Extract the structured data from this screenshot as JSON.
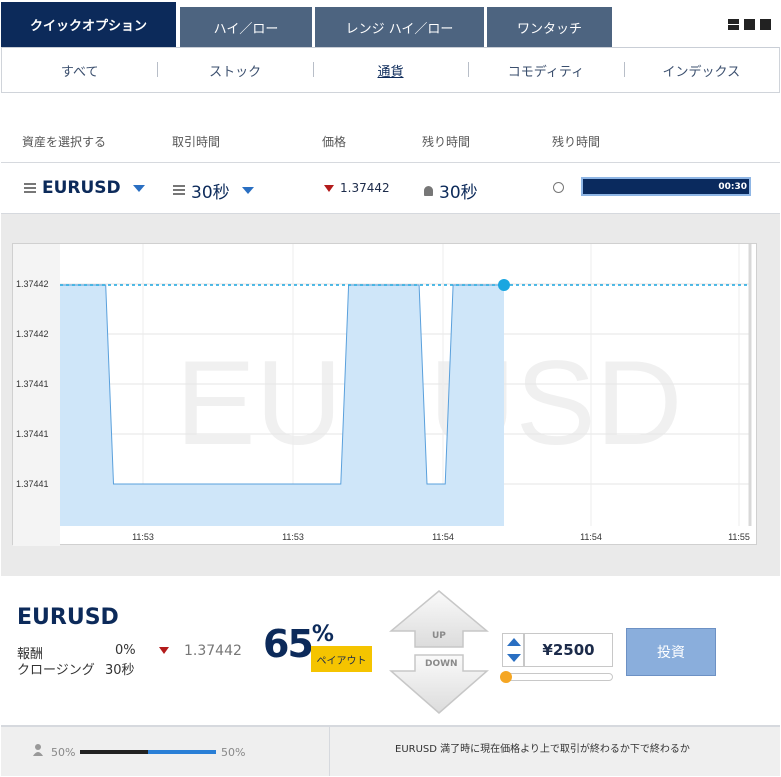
{
  "tabs": [
    {
      "label": "クイックオプション",
      "active": true
    },
    {
      "label": "ハイ／ロー",
      "active": false
    },
    {
      "label": "レンジ ハイ／ロー",
      "active": false
    },
    {
      "label": "ワンタッチ",
      "active": false
    }
  ],
  "categories": [
    {
      "label": "すべて",
      "active": false
    },
    {
      "label": "ストック",
      "active": false
    },
    {
      "label": "通貨",
      "active": true
    },
    {
      "label": "コモディティ",
      "active": false
    },
    {
      "label": "インデックス",
      "active": false
    }
  ],
  "column_labels": {
    "asset": "資産を選択する",
    "period": "取引時間",
    "price": "価格",
    "remaining1": "残り時間",
    "remaining2": "残り時間"
  },
  "selector": {
    "asset": "EURUSD",
    "duration": "30秒",
    "price": "1.37442",
    "remaining": "30秒",
    "timer": "00:30",
    "timer_progress_pct": 100
  },
  "chart_data": {
    "type": "area",
    "watermark": "EURUSD",
    "y_ticks": [
      "1.37442",
      "1.37442",
      "1.37441",
      "1.37441",
      "1.37441"
    ],
    "x_ticks": [
      "11:53",
      "11:53",
      "11:54",
      "11:54",
      "11:55"
    ],
    "current_price": "1.37442",
    "series_shape": [
      "high",
      "high",
      "low",
      "low",
      "low",
      "low",
      "low",
      "low",
      "low",
      "low",
      "low",
      "high",
      "high",
      "high",
      "low",
      "high",
      "high",
      "high"
    ],
    "fill_color": "#cfe6f9",
    "line_color": "#5aa0dc",
    "current_line_color": "#1aa6e0"
  },
  "panel": {
    "asset": "EURUSD",
    "payout_label": "報酬",
    "payout_value": "0%",
    "closing_label": "クロージング",
    "closing_value": "30秒",
    "price": "1.37442",
    "percent": "65",
    "percent_sign": "%",
    "payout_badge": "ペイアウト",
    "up": "UP",
    "down": "DOWN",
    "amount": "¥2500",
    "invest": "投資"
  },
  "footer": {
    "left_pct": "50%",
    "right_pct": "50%",
    "sentiment_up": 0.5,
    "message": "EURUSD 満了時に現在価格より上で取引が終わるか下で終わるか"
  }
}
